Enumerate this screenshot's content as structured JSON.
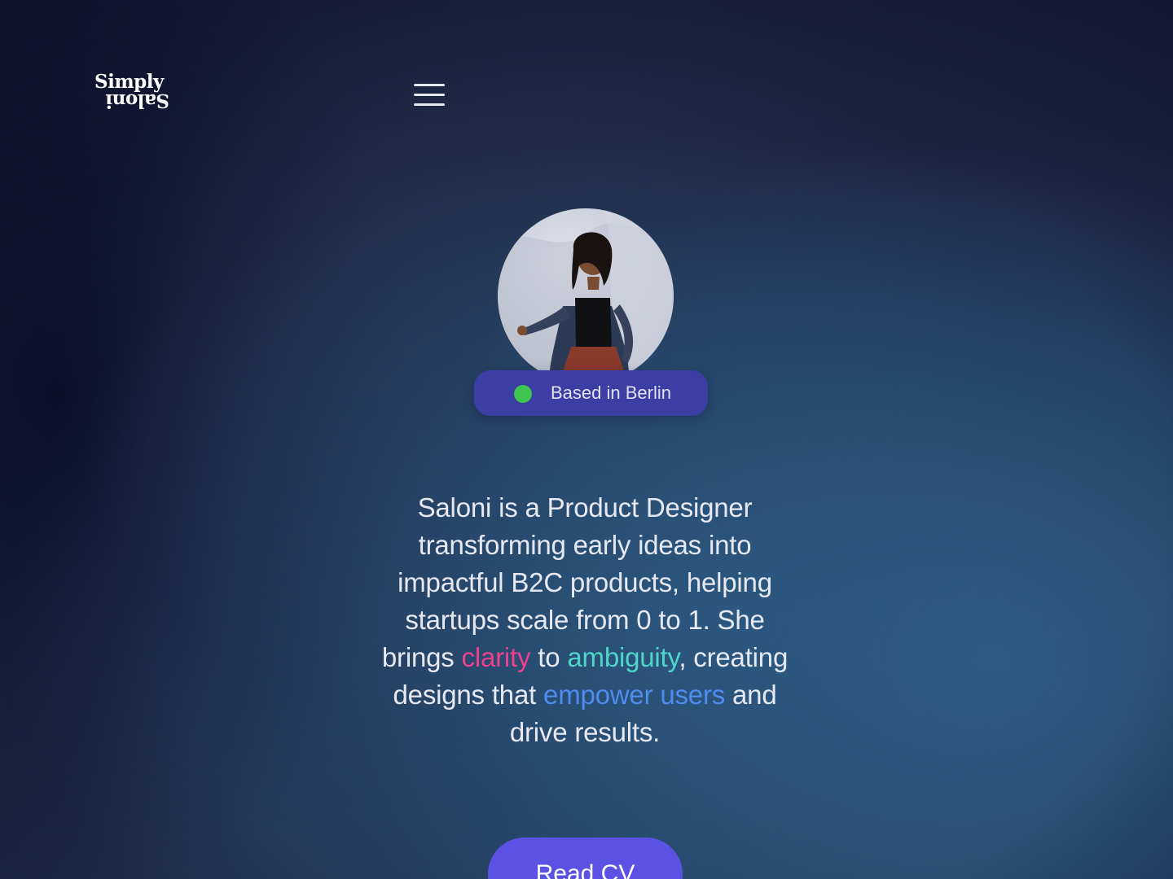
{
  "logo": {
    "line_top": "Simply",
    "line_bottom": "Saloni"
  },
  "nav": {
    "menu_icon": "hamburger-menu-icon"
  },
  "profile": {
    "avatar_alt": "Saloni",
    "location": "Based in Berlin",
    "status_color": "#3ec651"
  },
  "bio": {
    "part1": "Saloni is a Product Designer transforming early ideas into impactful B2C products, helping startups scale from 0 to 1. She brings ",
    "highlight1": "clarity",
    "part2": " to ",
    "highlight2": "ambiguity",
    "part3": ", creating designs that ",
    "highlight3": "empower users",
    "part4": " and drive results."
  },
  "cta": {
    "label": "Read CV"
  },
  "colors": {
    "accent": "#5a52e3",
    "badge": "#3b3ea2",
    "highlight_pink": "#ef3f8f",
    "highlight_teal": "#4fd6c8",
    "highlight_blue": "#4e8cf0"
  }
}
